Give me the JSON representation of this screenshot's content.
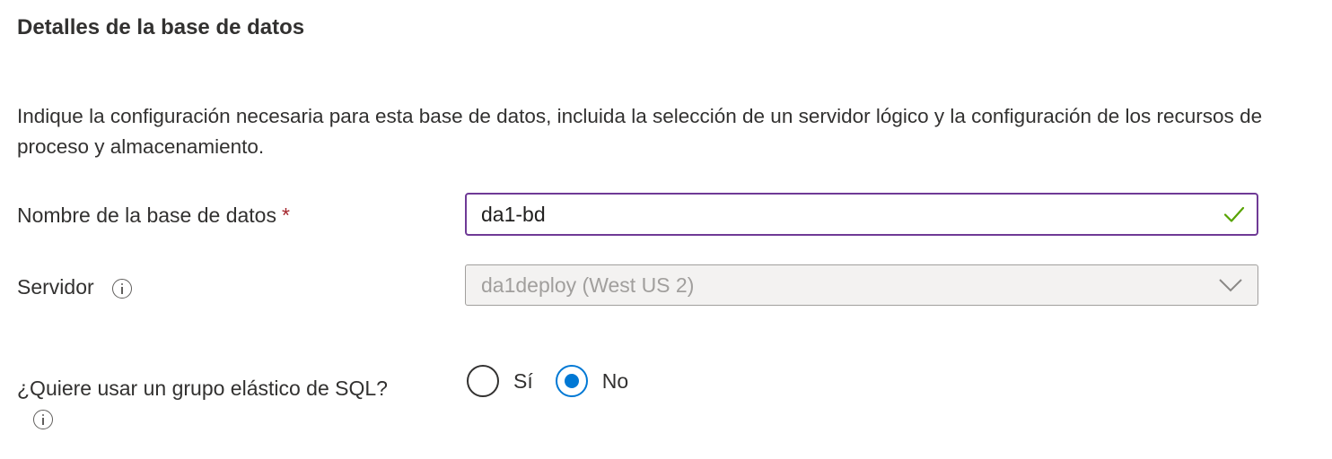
{
  "section": {
    "title": "Detalles de la base de datos",
    "description": "Indique la configuración necesaria para esta base de datos, incluida la selección de un servidor lógico y la configuración de los recursos de proceso y almacenamiento."
  },
  "database_name": {
    "label": "Nombre de la base de datos",
    "required_marker": "*",
    "value": "da1-bd",
    "validation_icon": "checkmark-icon",
    "validation_color": "#57a300"
  },
  "server": {
    "label": "Servidor",
    "info_icon": "info-icon",
    "value": "da1deploy (West US 2)",
    "disabled": true,
    "dropdown_icon": "chevron-down-icon"
  },
  "elastic_pool": {
    "label": "¿Quiere usar un grupo elástico de SQL?",
    "info_icon": "info-icon",
    "options": [
      {
        "label": "Sí",
        "selected": false
      },
      {
        "label": "No",
        "selected": true
      }
    ]
  },
  "colors": {
    "focus_border": "#6f3a96",
    "radio_selected": "#0078d4",
    "required": "#a4262c",
    "disabled_background": "#f3f2f1",
    "disabled_text": "#a19f9d"
  }
}
